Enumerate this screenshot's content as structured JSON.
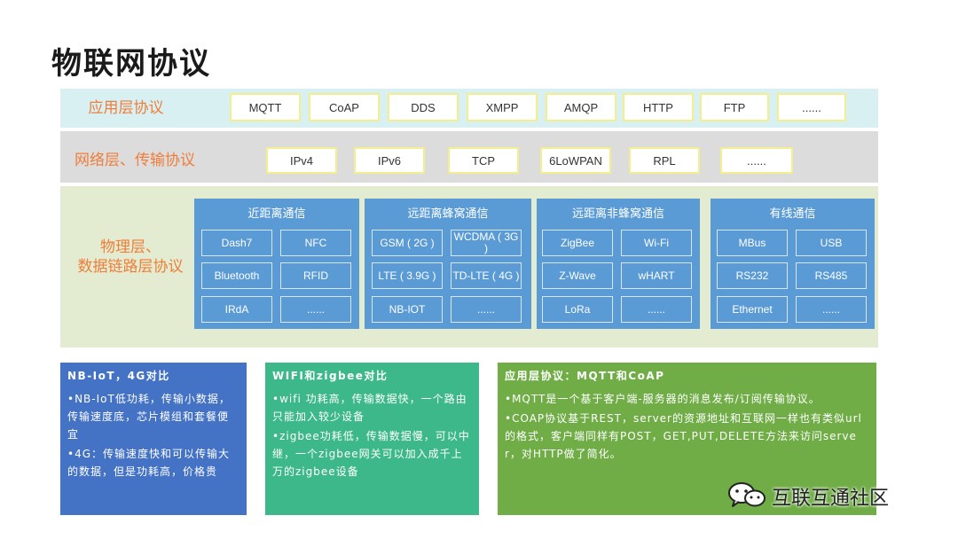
{
  "title": "物联网协议",
  "layers": {
    "application": {
      "label": "应用层协议",
      "protocols": [
        "MQTT",
        "CoAP",
        "DDS",
        "XMPP",
        "AMQP",
        "HTTP",
        "FTP",
        "......"
      ]
    },
    "network": {
      "label": "网络层、传输协议",
      "protocols": [
        "IPv4",
        "IPv6",
        "TCP",
        "6LoWPAN",
        "RPL",
        "......"
      ]
    },
    "physical": {
      "label_line1": "物理层、",
      "label_line2": "数据链路层协议",
      "groups": [
        {
          "title": "近距离通信",
          "items": [
            "Dash7",
            "NFC",
            "Bluetooth",
            "RFID",
            "IRdA",
            "......"
          ]
        },
        {
          "title": "远距离蜂窝通信",
          "items": [
            "GSM ( 2G )",
            "WCDMA ( 3G )",
            "LTE ( 3.9G )",
            "TD-LTE ( 4G )",
            "NB-IOT",
            "......"
          ]
        },
        {
          "title": "远距离非蜂窝通信",
          "items": [
            "ZigBee",
            "Wi-Fi",
            "Z-Wave",
            "wHART",
            "LoRa",
            "......"
          ]
        },
        {
          "title": "有线通信",
          "items": [
            "MBus",
            "USB",
            "RS232",
            "RS485",
            "Ethernet",
            "......"
          ]
        }
      ]
    }
  },
  "cards": [
    {
      "title": "NB-IoT，4G对比",
      "color": "#4472c4",
      "points": [
        "•NB-IoT低功耗，传输小数据，传输速度底，芯片模组和套餐便宜",
        "•4G：传输速度快和可以传输大的数据，但是功耗高，价格贵"
      ]
    },
    {
      "title": "WIFI和zigbee对比",
      "color": "#3db88a",
      "points": [
        "•wifi 功耗高，传输数据快，一个路由只能加入较少设备",
        "•zigbee功耗低，传输数据慢，可以中继，一个zigbee网关可以加入成千上万的zigbee设备"
      ]
    },
    {
      "title": "应用层协议：MQTT和CoAP",
      "color": "#70ad47",
      "points": [
        "•MQTT是一个基于客户端-服务器的消息发布/订阅传输协议。",
        "•COAP协议基于REST，server的资源地址和互联网一样也有类似url的格式，客户端同样有POST，GET,PUT,DELETE方法来访问server，对HTTP做了简化。"
      ]
    }
  ],
  "watermark": {
    "text": "互联互通社区",
    "icon": "wechat-icon"
  }
}
